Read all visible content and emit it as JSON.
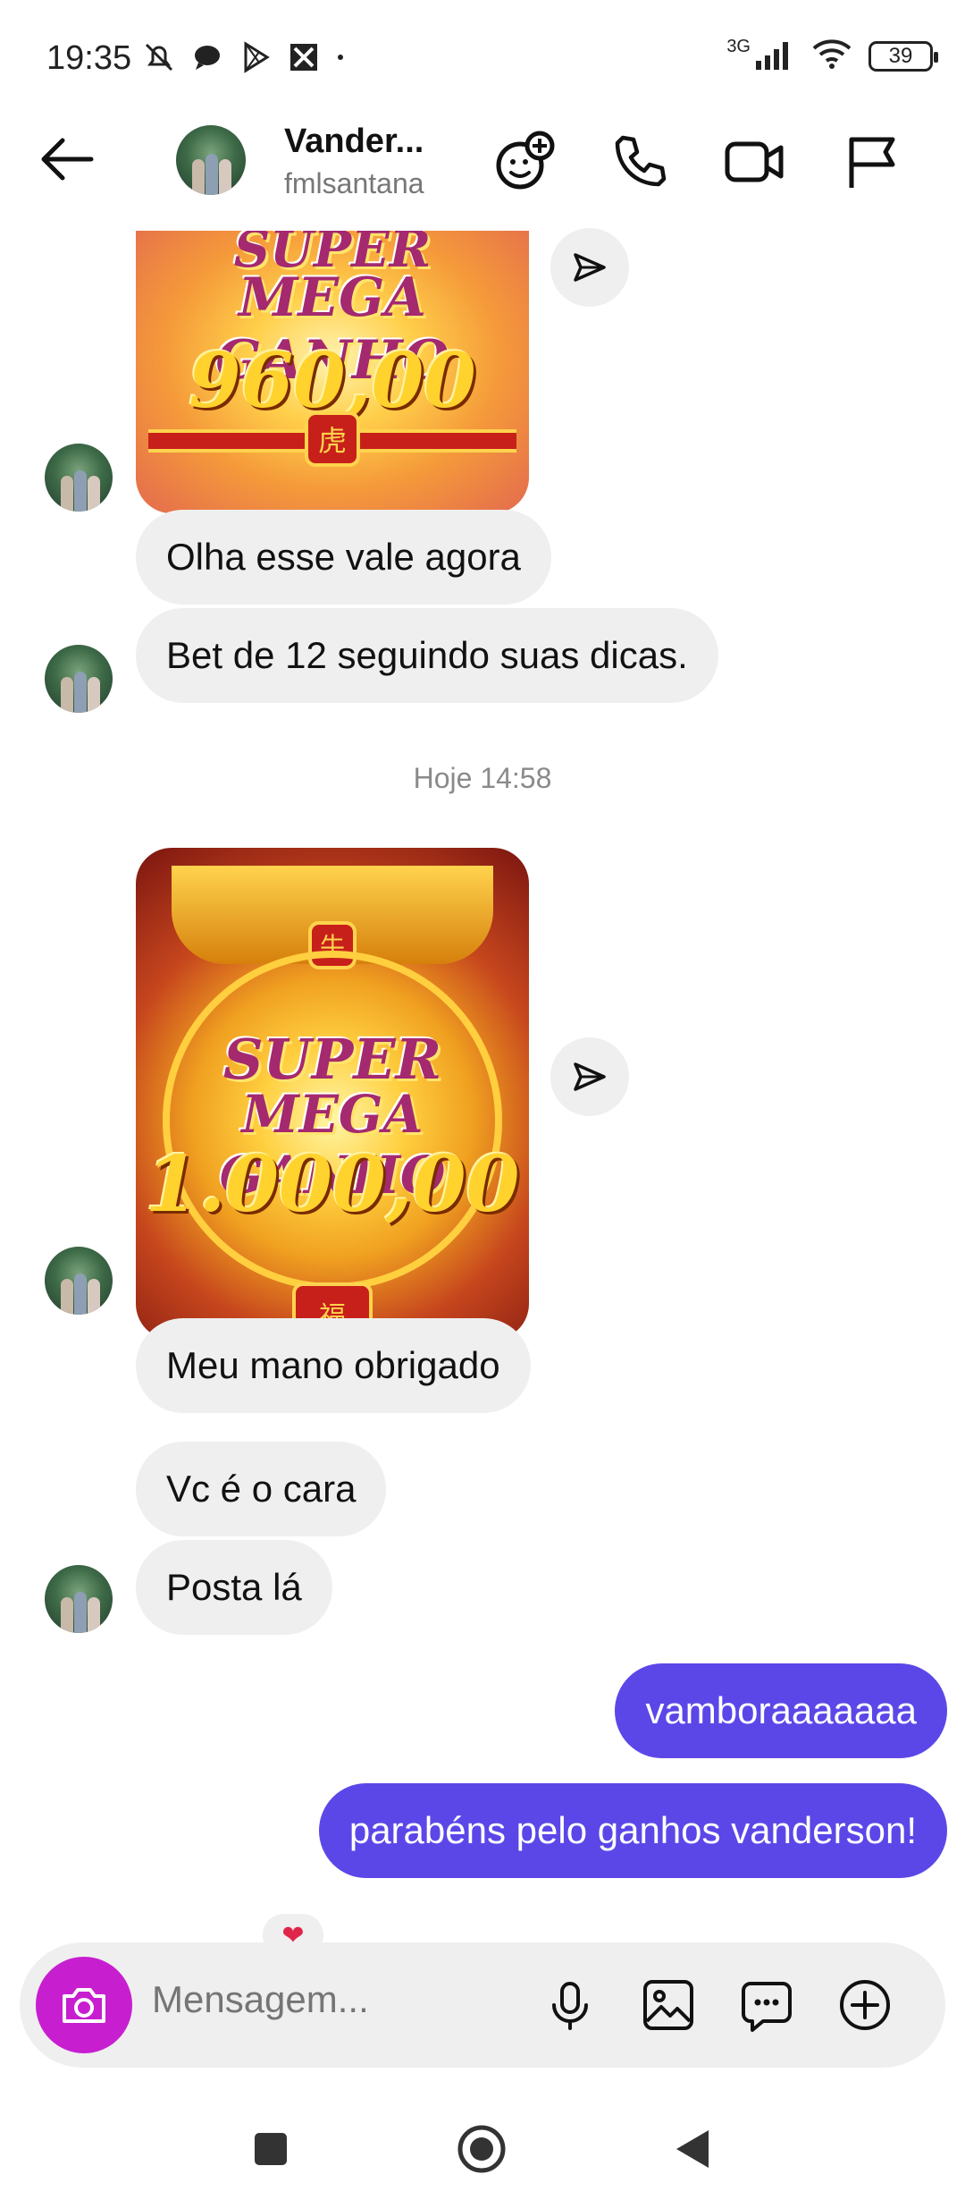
{
  "status_bar": {
    "time": "19:35",
    "network": "3G",
    "battery": "39"
  },
  "header": {
    "contact_name": "Vander...",
    "contact_handle": "fmlsantana",
    "icons": [
      "back-arrow-icon",
      "add-effect-icon",
      "phone-icon",
      "video-camera-icon",
      "flag-icon"
    ]
  },
  "messages": {
    "media1": {
      "line1": "SUPER",
      "line2": "MEGA GANHO",
      "value": "960,00",
      "seal": "虎"
    },
    "in1": "Olha esse vale agora",
    "in2": "Bet de 12 seguindo suas dicas.",
    "timestamp": "Hoje 14:58",
    "media2": {
      "line1": "SUPER",
      "line2": "MEGA GANHO",
      "value": "1.000,00",
      "seal_top": "牛",
      "seal_bottom": "福"
    },
    "in3": "Meu mano obrigado",
    "in4": "Vc é o cara",
    "in5": "Posta lá",
    "out1": "vamboraaaaaaa",
    "out2": "parabéns pelo ganhos vanderson!",
    "reaction": "❤"
  },
  "composer": {
    "placeholder": "Mensagem...",
    "camera_color": "#c71fd0"
  },
  "colors": {
    "outgoing_bubble": "#5b47e8",
    "incoming_bubble": "#efefef"
  }
}
